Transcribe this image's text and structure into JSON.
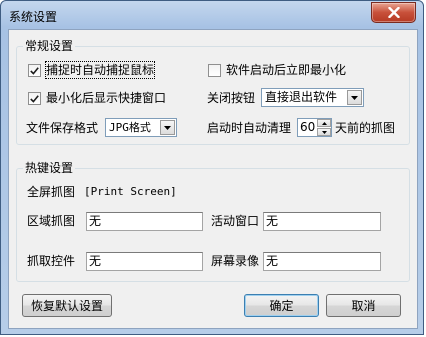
{
  "window": {
    "title": "系统设置"
  },
  "general": {
    "legend": "常规设置",
    "capture_mouse": {
      "label": "捕捉时自动捕捉鼠标",
      "checked": true
    },
    "minimize_on_start": {
      "label": "软件启动后立即最小化",
      "checked": false
    },
    "show_tray_on_minimize": {
      "label": "最小化后显示快捷窗口",
      "checked": true
    },
    "close_button": {
      "label": "关闭按钮",
      "value": "直接退出软件"
    },
    "file_format": {
      "label": "文件保存格式",
      "value": "JPG格式"
    },
    "auto_clean": {
      "prefix": "启动时自动清理",
      "value": "60",
      "suffix": "天前的抓图"
    }
  },
  "hotkeys": {
    "legend": "热键设置",
    "fullscreen": {
      "label": "全屏抓图",
      "value": "[Print Screen]"
    },
    "region": {
      "label": "区域抓图",
      "value": "无"
    },
    "active_window": {
      "label": "活动窗口",
      "value": "无"
    },
    "control": {
      "label": "抓取控件",
      "value": "无"
    },
    "recording": {
      "label": "屏幕录像",
      "value": "无"
    }
  },
  "buttons": {
    "restore_defaults": "恢复默认设置",
    "ok": "确定",
    "cancel": "取消"
  }
}
